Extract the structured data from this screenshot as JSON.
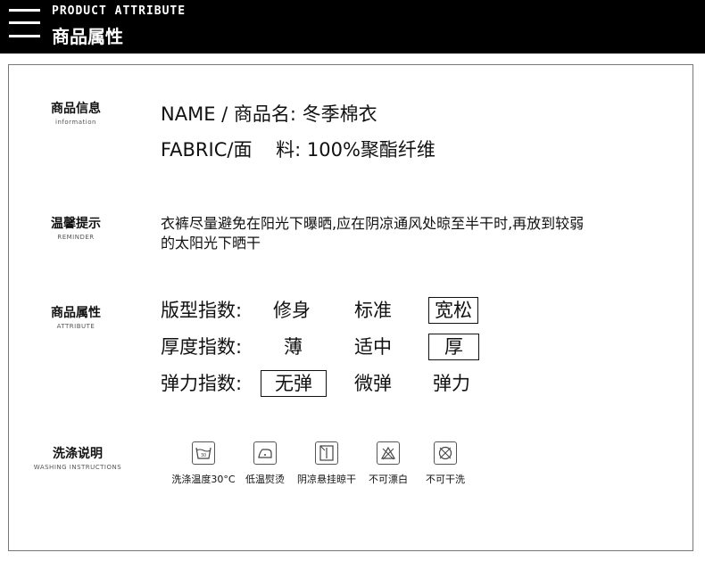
{
  "header": {
    "title_en": "PRODUCT ATTRIBUTE",
    "title_cn": "商品属性"
  },
  "info": {
    "title": "商品信息",
    "subtitle": "information",
    "name_line": "NAME / 商品名: 冬季棉衣",
    "fabric_line": "FABRIC/面    料: 100%聚酯纤维"
  },
  "reminder": {
    "title": "温馨提示",
    "subtitle": "REMINDER",
    "text_line1": "衣裤尽量避免在阳光下曝晒,应在阴凉通风处晾至半干时,再放到较弱",
    "text_line2": "的太阳光下晒干"
  },
  "attribute": {
    "title": "商品属性",
    "subtitle": "ATTRIBUTE",
    "rows": [
      {
        "label": "版型指数:",
        "options": [
          "修身",
          "标准",
          "宽松"
        ],
        "selected": 2
      },
      {
        "label": "厚度指数:",
        "options": [
          "薄",
          "适中",
          "厚"
        ],
        "selected": 2
      },
      {
        "label": "弹力指数:",
        "options": [
          "无弹",
          "微弹",
          "弹力"
        ],
        "selected": 0
      }
    ]
  },
  "washing": {
    "title": "洗涤说明",
    "subtitle": "WASHING INSTRUCTIONS",
    "items": [
      {
        "label": "洗涤温度30°C",
        "icon": "wash-30-icon"
      },
      {
        "label": "低温熨烫",
        "icon": "low-iron-icon"
      },
      {
        "label": "阴凉悬挂晾干",
        "icon": "hang-dry-shade-icon"
      },
      {
        "label": "不可漂白",
        "icon": "no-bleach-icon"
      },
      {
        "label": "不可干洗",
        "icon": "no-dry-clean-icon"
      }
    ]
  }
}
